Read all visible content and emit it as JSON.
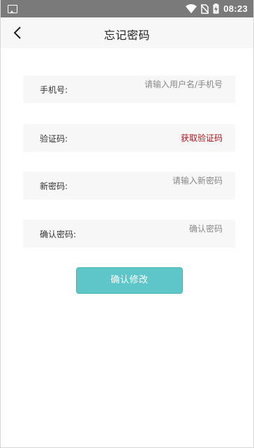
{
  "status_bar": {
    "time": "08:23",
    "icons": [
      "gallery-icon",
      "wifi-icon",
      "no-sim-icon",
      "battery-charging-icon"
    ]
  },
  "header": {
    "title": "忘记密码",
    "back_icon": "chevron-left-icon"
  },
  "form": {
    "phone": {
      "label": "手机号:",
      "placeholder": "请输入用户名/手机号",
      "value": ""
    },
    "code": {
      "label": "验证码:",
      "link_label": "获取验证码",
      "link_color": "#b0171d"
    },
    "new_password": {
      "label": "新密码:",
      "placeholder": "请输入新密码",
      "value": ""
    },
    "confirm_password": {
      "label": "确认密码:",
      "placeholder": "确认密码",
      "value": ""
    }
  },
  "actions": {
    "submit_label": "确认修改",
    "submit_color": "#5ec6c8"
  }
}
